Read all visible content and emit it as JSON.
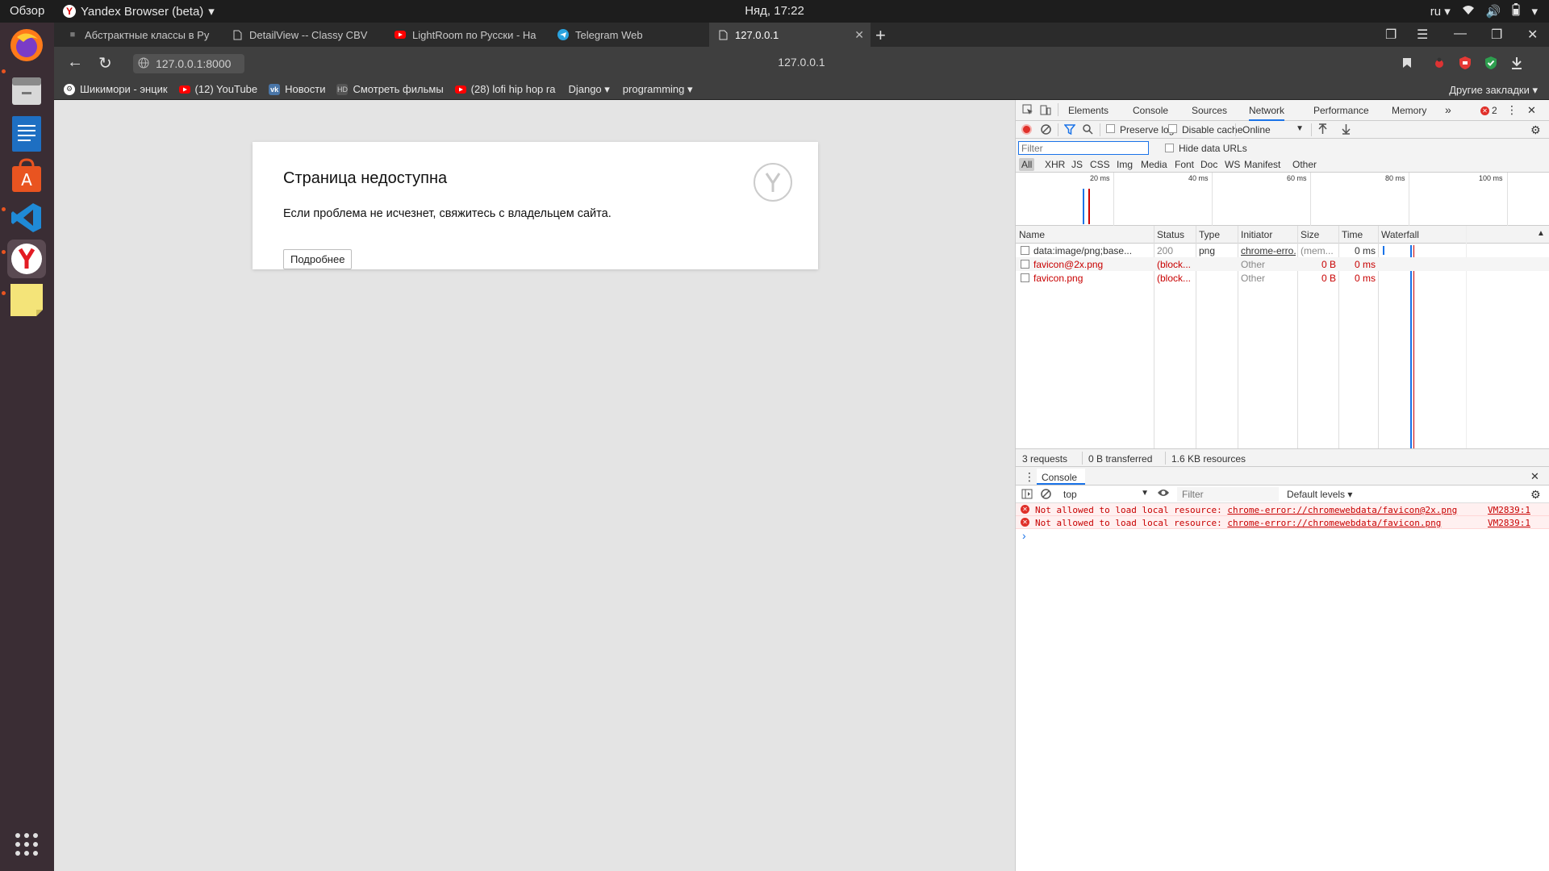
{
  "topbar": {
    "overview": "Обзор",
    "app_name": "Yandex Browser (beta)",
    "clock": "Няд, 17:22",
    "lang": "ru"
  },
  "tabs": [
    {
      "title": "Абстрактные классы в Py"
    },
    {
      "title": "DetailView -- Classy CBV"
    },
    {
      "title": "LightRoom по Русски - На"
    },
    {
      "title": "Telegram Web"
    },
    {
      "title": "127.0.0.1"
    }
  ],
  "address": {
    "url": "127.0.0.1:8000",
    "page_title": "127.0.0.1"
  },
  "bookmarks": {
    "items": [
      {
        "label": "Шикимори - энцик"
      },
      {
        "label": "(12) YouTube"
      },
      {
        "label": "Новости"
      },
      {
        "label": "Смотреть фильмы"
      },
      {
        "label": "(28) lofi hip hop ra"
      },
      {
        "label": "Django ▾"
      },
      {
        "label": "programming ▾"
      }
    ],
    "other": "Другие закладки ▾"
  },
  "error_page": {
    "title": "Страница недоступна",
    "message": "Если проблема не исчезнет, свяжитесь с владельцем сайта.",
    "details_button": "Подробнее"
  },
  "devtools": {
    "tabs": [
      "Elements",
      "Console",
      "Sources",
      "Network",
      "Performance",
      "Memory"
    ],
    "active_tab": "Network",
    "error_count": "2",
    "preserve_log": "Preserve log",
    "disable_cache": "Disable cache",
    "throttle": "Online",
    "filter_placeholder": "Filter",
    "hide_data_urls": "Hide data URLs",
    "types": [
      "All",
      "XHR",
      "JS",
      "CSS",
      "Img",
      "Media",
      "Font",
      "Doc",
      "WS",
      "Manifest",
      "Other"
    ],
    "timeline_ticks": [
      "20 ms",
      "40 ms",
      "60 ms",
      "80 ms",
      "100 ms"
    ],
    "columns": [
      "Name",
      "Status",
      "Type",
      "Initiator",
      "Size",
      "Time",
      "Waterfall"
    ],
    "rows": [
      {
        "name": "data:image/png;base...",
        "status": "200",
        "type": "png",
        "initiator": "chrome-erro...",
        "size": "(mem...",
        "time": "0 ms",
        "error": false
      },
      {
        "name": "favicon@2x.png",
        "status": "(block...",
        "type": "",
        "initiator": "Other",
        "size": "0 B",
        "time": "0 ms",
        "error": true
      },
      {
        "name": "favicon.png",
        "status": "(block...",
        "type": "",
        "initiator": "Other",
        "size": "0 B",
        "time": "0 ms",
        "error": true
      }
    ],
    "summary": {
      "requests": "3 requests",
      "transferred": "0 B transferred",
      "resources": "1.6 KB resources"
    },
    "console": {
      "title": "Console",
      "context": "top",
      "filter_placeholder": "Filter",
      "levels": "Default levels ▾",
      "messages": [
        {
          "prefix": "Not allowed to load local resource: ",
          "url": "chrome-error://chromewebdata/favicon@2x.png",
          "source": "VM2839:1"
        },
        {
          "prefix": "Not allowed to load local resource: ",
          "url": "chrome-error://chromewebdata/favicon.png",
          "source": "VM2839:1"
        }
      ],
      "prompt": "›"
    }
  }
}
